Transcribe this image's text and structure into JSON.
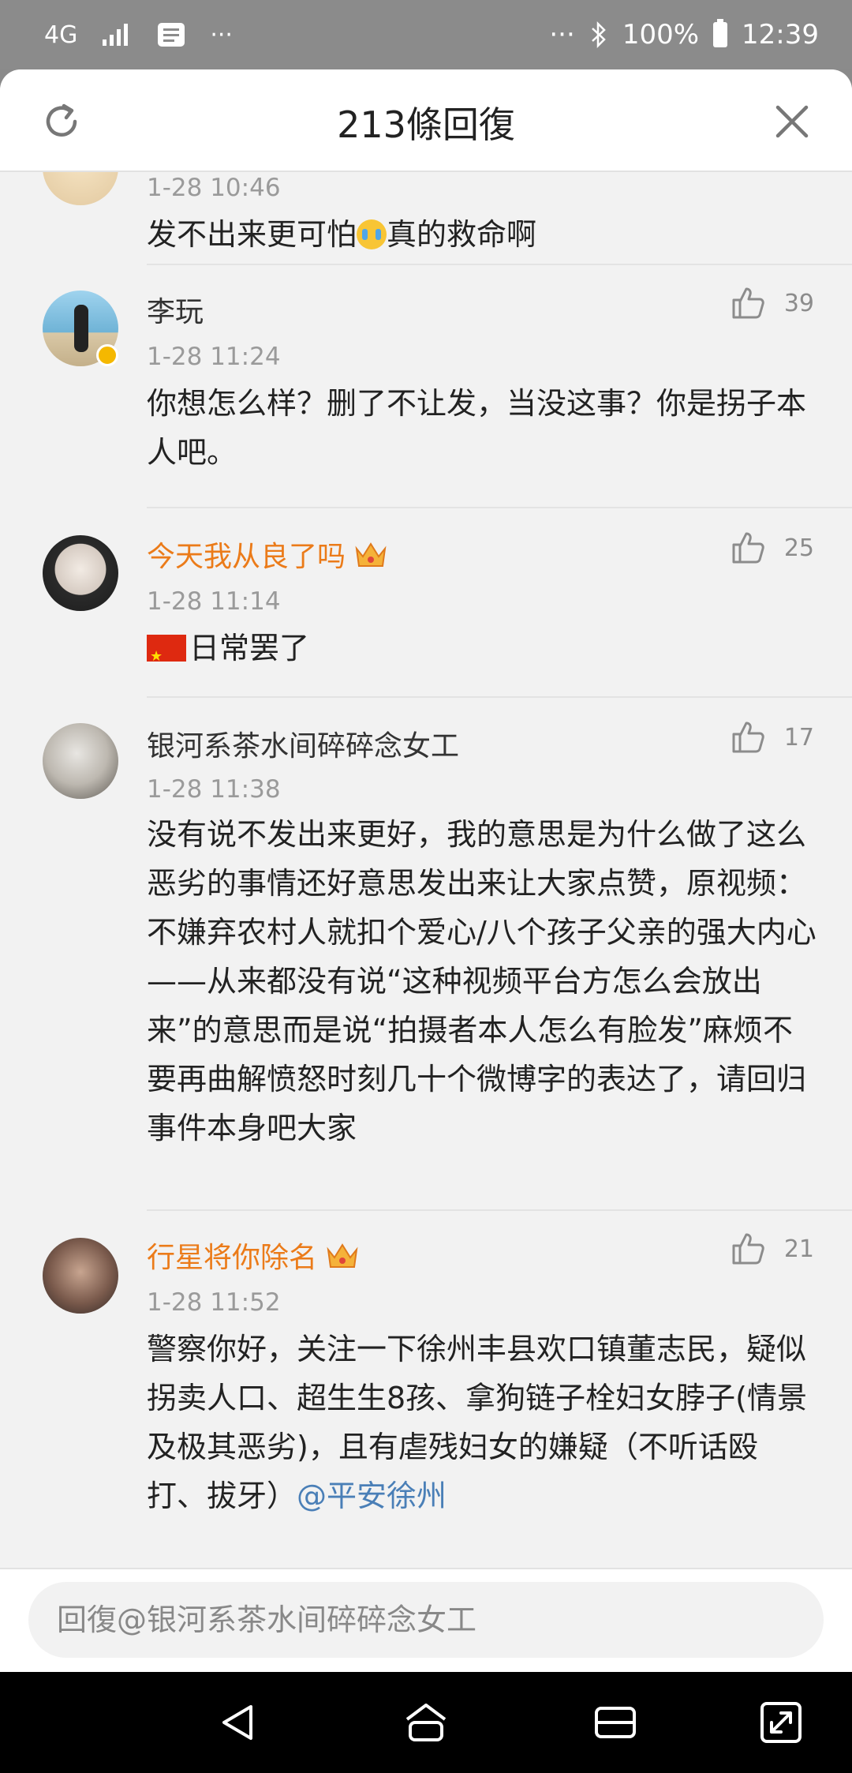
{
  "status_bar": {
    "network": "4G",
    "more_left": "···",
    "more_right": "···",
    "battery": "100%",
    "time": "12:39"
  },
  "header": {
    "title": "213條回復"
  },
  "comments": [
    {
      "name": "",
      "time": "1-28 10:46",
      "text_before": "发不出来更可怕",
      "text_after": "真的救命啊"
    },
    {
      "name": "李玩",
      "time": "1-28 11:24",
      "likes": "39",
      "text": "你想怎么样？删了不让发，当没这事？你是拐子本人吧。"
    },
    {
      "name": "今天我从良了吗",
      "time": "1-28 11:14",
      "likes": "25",
      "text": "日常罢了"
    },
    {
      "name": "银河系茶水间碎碎念女工",
      "time": "1-28 11:38",
      "likes": "17",
      "text": "没有说不发出来更好，我的意思是为什么做了这么恶劣的事情还好意思发出来让大家点赞，原视频：不嫌弃农村人就扣个爱心/八个孩子父亲的强大内心——从来都没有说“这种视频平台方怎么会放出来”的意思而是说“拍摄者本人怎么有脸发”麻烦不要再曲解愤怒时刻几十个微博字的表达了，请回归事件本身吧大家"
    },
    {
      "name": "行星将你除名",
      "time": "1-28 11:52",
      "likes": "21",
      "text": "警察你好，关注一下徐州丰县欢口镇董志民，疑似拐卖人口、超生生8孩、拿狗链子栓妇女脖子(情景及极其恶劣)，且有虐残妇女的嫌疑（不听话殴打、拔牙）",
      "mention": "@平安徐州"
    }
  ],
  "reply": {
    "placeholder": "回復@银河系茶水间碎碎念女工"
  }
}
